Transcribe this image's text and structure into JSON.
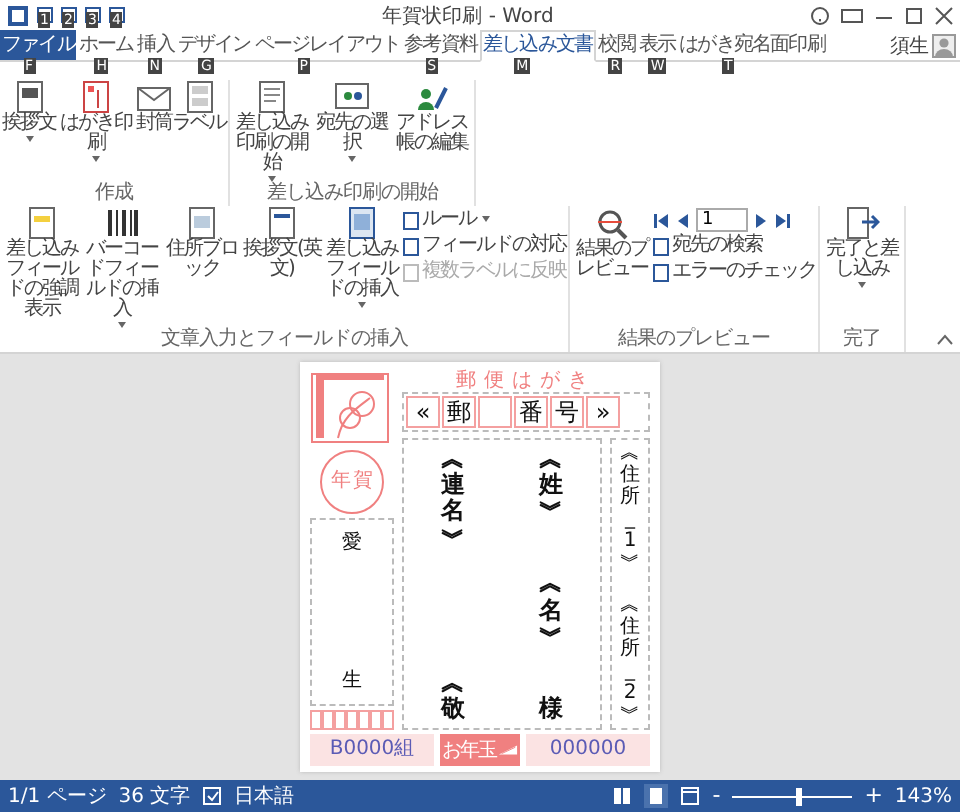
{
  "window": {
    "title": "年賀状印刷 - Word",
    "quick_access_keytips": [
      "1",
      "2",
      "3",
      "4"
    ]
  },
  "tabs": [
    {
      "label": "ファイル",
      "keytip": "F",
      "kind": "file",
      "selected": false
    },
    {
      "label": "ホーム",
      "keytip": "H",
      "kind": "tab",
      "selected": false
    },
    {
      "label": "挿入",
      "keytip": "N",
      "kind": "tab",
      "selected": false
    },
    {
      "label": "デザイン",
      "keytip": "G",
      "kind": "tab",
      "selected": false
    },
    {
      "label": "ページレイアウト",
      "keytip": "P",
      "kind": "tab",
      "selected": false
    },
    {
      "label": "参考資料",
      "keytip": "S",
      "kind": "tab",
      "selected": false
    },
    {
      "label": "差し込み文書",
      "keytip": "M",
      "kind": "tab",
      "selected": true
    },
    {
      "label": "校閲",
      "keytip": "R",
      "kind": "tab",
      "selected": false
    },
    {
      "label": "表示",
      "keytip": "W",
      "kind": "tab",
      "selected": false
    },
    {
      "label": "はがき宛名面印刷",
      "keytip": "T",
      "kind": "tab",
      "selected": false
    }
  ],
  "user": {
    "name": "須生"
  },
  "ribbon": {
    "groups": [
      {
        "label": "作成",
        "items": [
          {
            "kind": "large",
            "label": "挨拶文",
            "dropdown": true
          },
          {
            "kind": "large",
            "label": "はがき印刷",
            "dropdown": true
          },
          {
            "kind": "large",
            "label": "封筒",
            "dropdown": false
          },
          {
            "kind": "large",
            "label": "ラベル",
            "dropdown": false
          }
        ]
      },
      {
        "label": "差し込み印刷の開始",
        "items": [
          {
            "kind": "large",
            "label": "差し込み印刷の開始",
            "dropdown": true
          },
          {
            "kind": "large",
            "label": "宛先の選択",
            "dropdown": true
          },
          {
            "kind": "large",
            "label": "アドレス帳の編集",
            "dropdown": false
          }
        ]
      },
      {
        "label": "文章入力とフィールドの挿入",
        "items": [
          {
            "kind": "large",
            "label": "差し込みフィールドの強調表示",
            "dropdown": false
          },
          {
            "kind": "large",
            "label": "バーコードフィールドの挿入",
            "dropdown": true
          },
          {
            "kind": "large",
            "label": "住所ブロック",
            "dropdown": false
          },
          {
            "kind": "large",
            "label": "挨拶文(英文)",
            "dropdown": false
          },
          {
            "kind": "large",
            "label": "差し込みフィールドの挿入",
            "dropdown": true
          },
          {
            "kind": "stack",
            "entries": [
              {
                "label": "ルール",
                "dropdown": true,
                "disabled": false
              },
              {
                "label": "フィールドの対応",
                "dropdown": false,
                "disabled": false
              },
              {
                "label": "複数ラベルに反映",
                "dropdown": false,
                "disabled": true
              }
            ]
          }
        ]
      },
      {
        "label": "結果のプレビュー",
        "items": [
          {
            "kind": "large",
            "label": "結果のプレビュー",
            "dropdown": false
          },
          {
            "kind": "nav",
            "record": "1",
            "entries": [
              {
                "label": "宛先の検索",
                "dropdown": false,
                "disabled": false
              },
              {
                "label": "エラーのチェック",
                "dropdown": false,
                "disabled": false
              }
            ]
          }
        ]
      },
      {
        "label": "完了",
        "items": [
          {
            "kind": "large",
            "label": "完了と差し込み",
            "dropdown": true
          }
        ]
      }
    ]
  },
  "postcard": {
    "heading": "郵便はがき",
    "postal_code_boxes": [
      {
        "kind": "char",
        "text": "«"
      },
      {
        "kind": "char",
        "text": "郵"
      },
      {
        "kind": "blank"
      },
      {
        "kind": "char",
        "text": "番"
      },
      {
        "kind": "char",
        "text": "号"
      },
      {
        "kind": "char",
        "text": "»"
      }
    ],
    "postmark": [
      "年",
      "賀"
    ],
    "address_lines": [
      "︽住所_1︾",
      "︽住所_2︾"
    ],
    "recipient_columns": [
      [
        "︽連名︾",
        "︽敬"
      ],
      [
        "︽姓︾",
        "︽名︾",
        "様"
      ]
    ],
    "sender": {
      "top": "愛",
      "bottom": "生"
    },
    "lottery_group": "B0000組",
    "lottery_label": "お年玉",
    "lottery_number": "000000"
  },
  "status_bar": {
    "page": "1/1 ページ",
    "words": "36 文字",
    "language": "日本語",
    "zoom_out": "-",
    "zoom_in": "+",
    "zoom": "143%",
    "zoom_slider": {
      "level": 0.55
    }
  }
}
